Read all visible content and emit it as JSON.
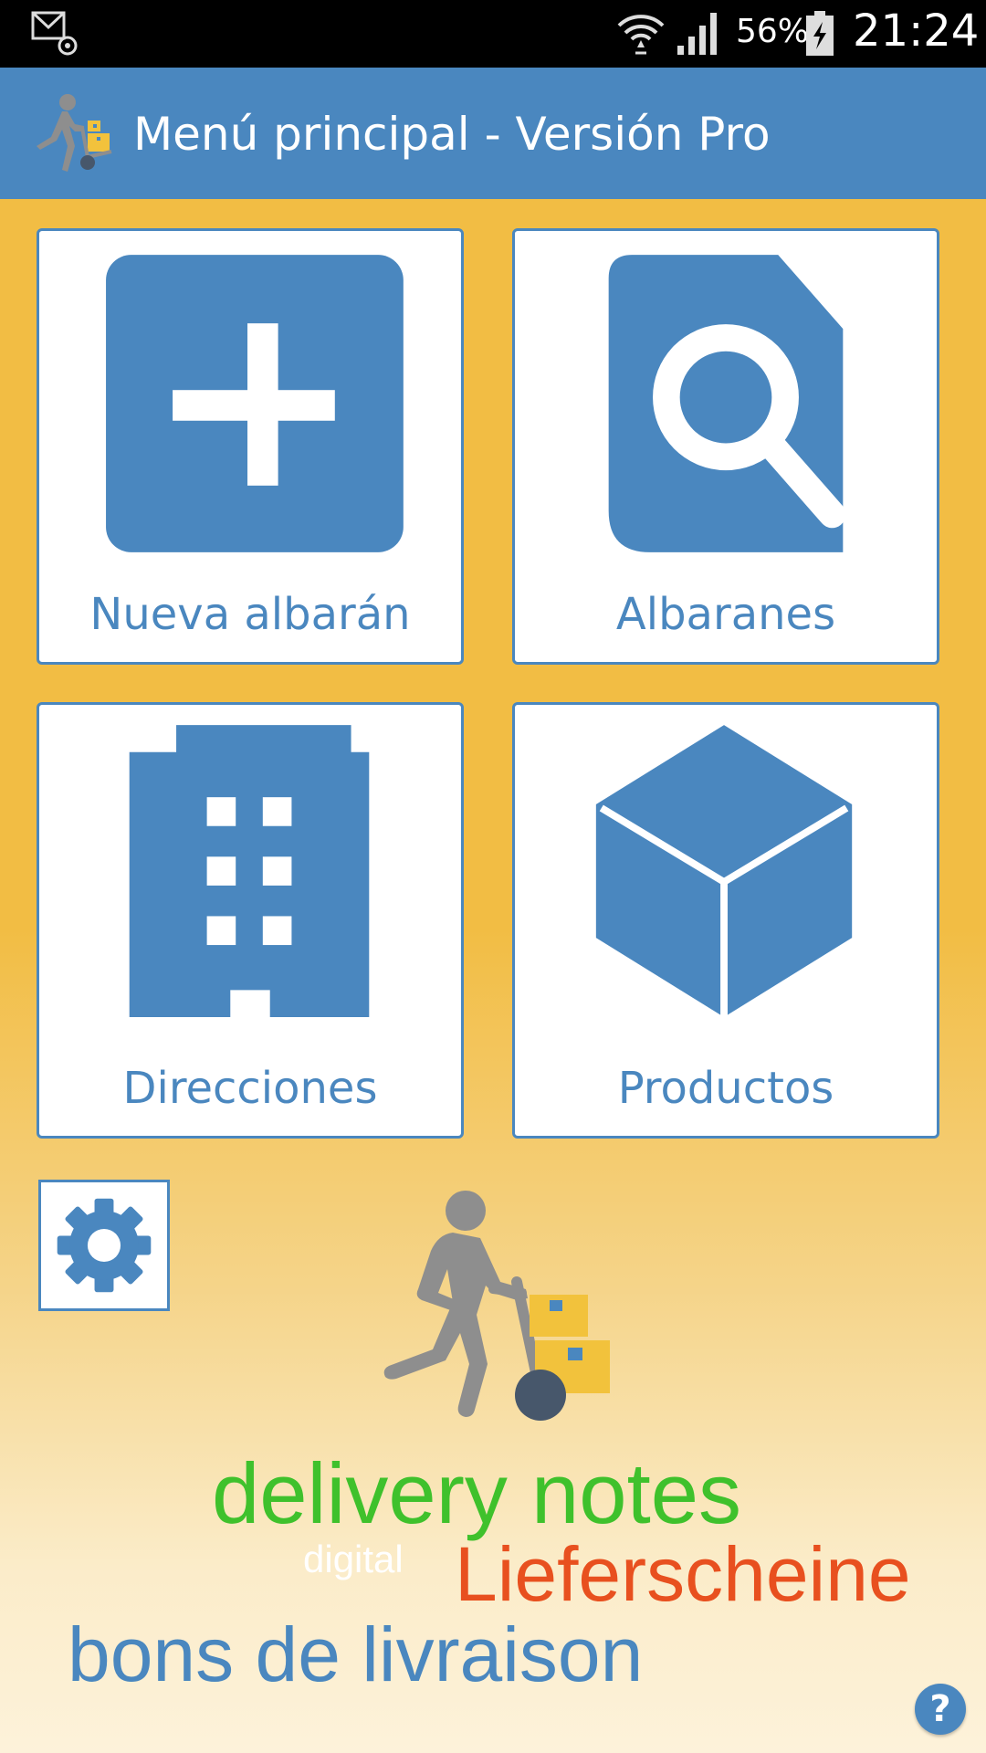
{
  "status_bar": {
    "battery_percent": "56%",
    "time": "21:24",
    "icons": [
      "email-notification-icon",
      "wifi-icon",
      "signal-icon",
      "battery-charging-icon"
    ]
  },
  "app_bar": {
    "title": "Menú principal - Versión Pro",
    "logo_icon": "delivery-person-logo-icon"
  },
  "tiles": {
    "new_note": {
      "label": "Nueva albarán",
      "icon": "add-icon"
    },
    "notes": {
      "label": "Albaranes",
      "icon": "document-search-icon"
    },
    "addresses": {
      "label": "Direcciones",
      "icon": "building-icon"
    },
    "products": {
      "label": "Productos",
      "icon": "box-icon"
    }
  },
  "settings": {
    "icon": "gear-icon"
  },
  "word_cloud": {
    "delivery": "delivery notes",
    "digital": "digital",
    "lieferscheine": "Lieferscheine",
    "bons": "bons de livraison"
  },
  "help": {
    "label": "?"
  },
  "colors": {
    "accent": "#4a87bf",
    "background": "#f2bd44",
    "green": "#3fc12c",
    "orange": "#e8501f"
  }
}
